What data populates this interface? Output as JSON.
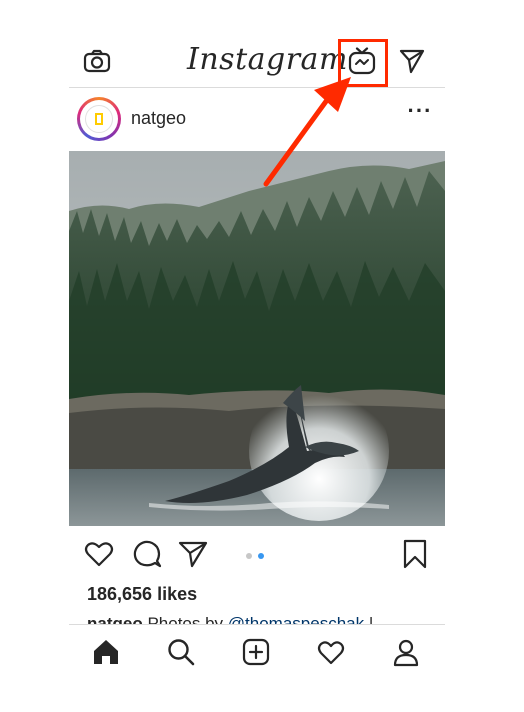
{
  "app": {
    "title": "Instagram"
  },
  "header": {
    "camera_icon": "camera-icon",
    "igtv_icon": "igtv-icon",
    "direct_icon": "paper-plane-icon"
  },
  "post": {
    "username": "natgeo",
    "avatar_text": "NATIONAL GEOGRAPHIC",
    "more_label": "···",
    "image_desc": "humpback whale tail",
    "likes": "186,656 likes",
    "caption_user": "natgeo",
    "caption_text": " Photos by ",
    "caption_mention": "@thomaspeschak",
    "caption_tail": " |",
    "carousel": {
      "total": 2,
      "current": 2
    }
  },
  "actions": {
    "like_icon": "heart-icon",
    "comment_icon": "comment-icon",
    "share_icon": "paper-plane-icon",
    "save_icon": "bookmark-icon"
  },
  "tabbar": {
    "items": [
      "home-icon",
      "search-icon",
      "add-post-icon",
      "activity-heart-icon",
      "profile-icon"
    ]
  },
  "annotation": {
    "color": "#ff2a00"
  },
  "colors": {
    "text": "#262626",
    "accent_blue": "#3897f0",
    "border": "#dbdbdb"
  }
}
